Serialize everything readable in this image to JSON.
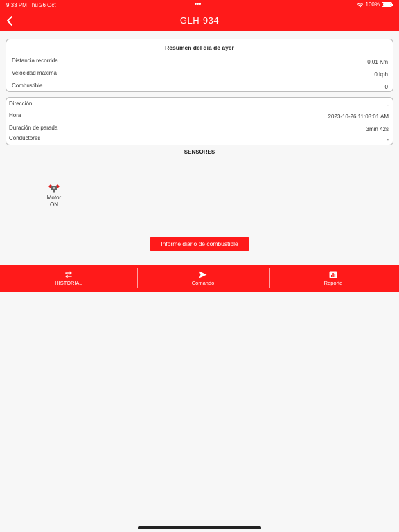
{
  "status": {
    "time": "9:33 PM",
    "date": "Thu 26 Oct",
    "dots": "•••",
    "battery": "100%"
  },
  "nav": {
    "title": "GLH-934",
    "back_icon": "chevron-left-icon"
  },
  "summary": {
    "title": "Resumen del día de ayer",
    "rows": [
      {
        "label": "Distancia recorrida",
        "value": "0.01 Km"
      },
      {
        "label": "Velocidad máxima",
        "value": "0 kph"
      },
      {
        "label": "Combustible",
        "value": "0"
      }
    ]
  },
  "details": {
    "rows": [
      {
        "label": "Dirección",
        "value": "-"
      },
      {
        "label": "Hora",
        "value": "2023-10-26 11:03:01 AM"
      },
      {
        "label": "Duración de parada",
        "value": "3min 42s"
      },
      {
        "label": "Conductores",
        "value": "-"
      }
    ]
  },
  "sensors": {
    "title": "SENSORES",
    "items": [
      {
        "name": "Motor",
        "state": "ON",
        "icon": "engine-icon"
      }
    ]
  },
  "fuel_button": {
    "label": "Informe diario de combustible"
  },
  "tabs": [
    {
      "label": "HISTORIAL",
      "icon": "repeat-icon"
    },
    {
      "label": "Comando",
      "icon": "send-icon"
    },
    {
      "label": "Reporte",
      "icon": "report-icon"
    }
  ],
  "colors": {
    "accent": "#ff1a1a",
    "background": "#f7f7f7",
    "card": "#ffffff"
  }
}
